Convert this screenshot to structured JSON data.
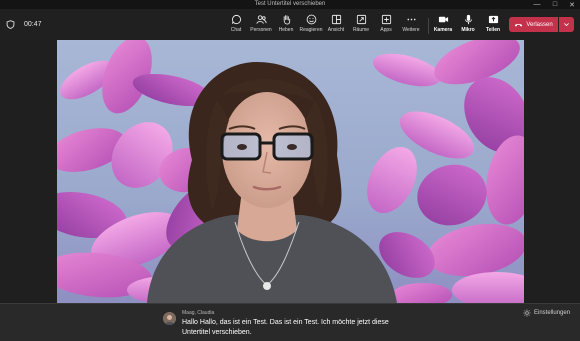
{
  "window": {
    "title": "Test Untertitel verschieben"
  },
  "meeting": {
    "timer": "00:47"
  },
  "toolbar": {
    "chat": "Chat",
    "people": "Personen",
    "raise": "Heben",
    "react": "Reagieren",
    "view": "Ansicht",
    "rooms": "Räume",
    "apps": "Apps",
    "more": "Weitere",
    "camera": "Kamera",
    "mic": "Mikro",
    "share": "Teilen",
    "leave": "Verlassen"
  },
  "colors": {
    "leave": "#c4314b",
    "background": "#1f1f1f"
  },
  "caption": {
    "speaker": "Maag, Claudia",
    "text": "Hallo Hallo, das ist ein Test. Das ist ein Test. Ich möchte jetzt diese Untertitel verschieben.",
    "settings": "Einstellungen"
  }
}
